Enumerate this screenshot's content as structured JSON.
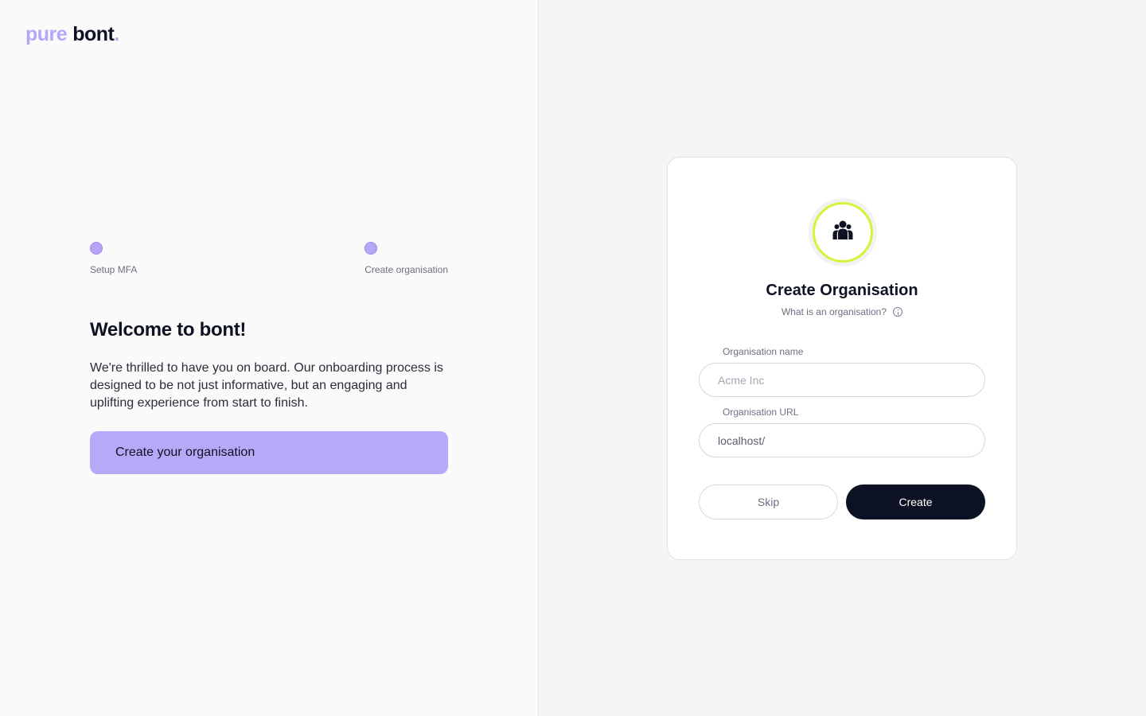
{
  "logo": {
    "part1": "pure",
    "part2": "bont",
    "dot": "."
  },
  "steps": [
    {
      "label": "Setup MFA"
    },
    {
      "label": "Create organisation"
    }
  ],
  "welcome": {
    "title": "Welcome to bont!",
    "body": "We're thrilled to have you on board. Our onboarding process is designed to be not just informative, but an engaging and uplifting experience from start to finish.",
    "cta_label": "Create your organisation"
  },
  "card": {
    "icon": "users-icon",
    "title": "Create Organisation",
    "subtitle": "What is an organisation?",
    "fields": {
      "name_label": "Organisation name",
      "name_placeholder": "Acme Inc",
      "url_label": "Organisation URL",
      "url_value": "localhost/"
    },
    "skip_label": "Skip",
    "create_label": "Create"
  },
  "colors": {
    "accent": "#b7a8f8",
    "badge_ring": "#d8f23a",
    "primary_button": "#0c1124"
  }
}
